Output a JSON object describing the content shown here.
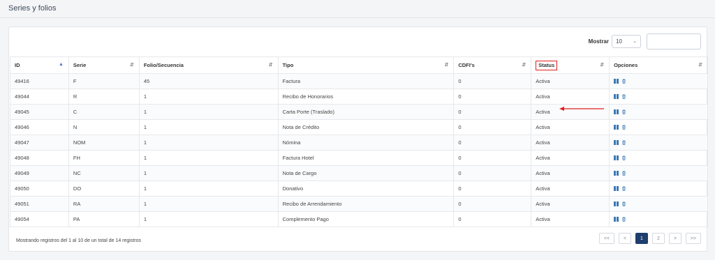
{
  "page": {
    "title": "Series y folios"
  },
  "toolbar": {
    "show_label": "Mostrar",
    "page_size": "10",
    "search_value": ""
  },
  "columns": [
    "ID",
    "Serie",
    "Folio/Secuencia",
    "Tipo",
    "CDFI's",
    "Status",
    "Opciones"
  ],
  "rows": [
    {
      "id": "49416",
      "serie": "F",
      "folio": "45",
      "tipo": "Factura",
      "cfdis": "0",
      "status": "Activa"
    },
    {
      "id": "49044",
      "serie": "R",
      "folio": "1",
      "tipo": "Recibo de Honorarios",
      "cfdis": "0",
      "status": "Activa"
    },
    {
      "id": "49045",
      "serie": "C",
      "folio": "1",
      "tipo": "Carta Porte (Traslado)",
      "cfdis": "0",
      "status": "Activa"
    },
    {
      "id": "49046",
      "serie": "N",
      "folio": "1",
      "tipo": "Nota de Crédito",
      "cfdis": "0",
      "status": "Activa"
    },
    {
      "id": "49047",
      "serie": "NOM",
      "folio": "1",
      "tipo": "Nómina",
      "cfdis": "0",
      "status": "Activa"
    },
    {
      "id": "49048",
      "serie": "FH",
      "folio": "1",
      "tipo": "Factura Hotel",
      "cfdis": "0",
      "status": "Activa"
    },
    {
      "id": "49049",
      "serie": "NC",
      "folio": "1",
      "tipo": "Nota de Cargo",
      "cfdis": "0",
      "status": "Activa"
    },
    {
      "id": "49050",
      "serie": "DO",
      "folio": "1",
      "tipo": "Donativo",
      "cfdis": "0",
      "status": "Activa"
    },
    {
      "id": "49051",
      "serie": "RA",
      "folio": "1",
      "tipo": "Recibo de Arrendamiento",
      "cfdis": "0",
      "status": "Activa"
    },
    {
      "id": "49054",
      "serie": "PA",
      "folio": "1",
      "tipo": "Complemento Pago",
      "cfdis": "0",
      "status": "Activa"
    }
  ],
  "footer": {
    "info": "Mostrando registros del 1 al 10 de un total de 14 registros"
  },
  "pagination": {
    "first": "<<",
    "prev": "<",
    "pages": [
      "1",
      "2"
    ],
    "active": "1",
    "next": ">",
    "last": ">>"
  },
  "colors": {
    "accent": "#1e3f6e",
    "highlight": "#e01e1e",
    "icon": "#3c78b4"
  },
  "icons": {
    "pause": "pause-icon",
    "delete": "trash-icon",
    "sort": "sort-icon"
  }
}
